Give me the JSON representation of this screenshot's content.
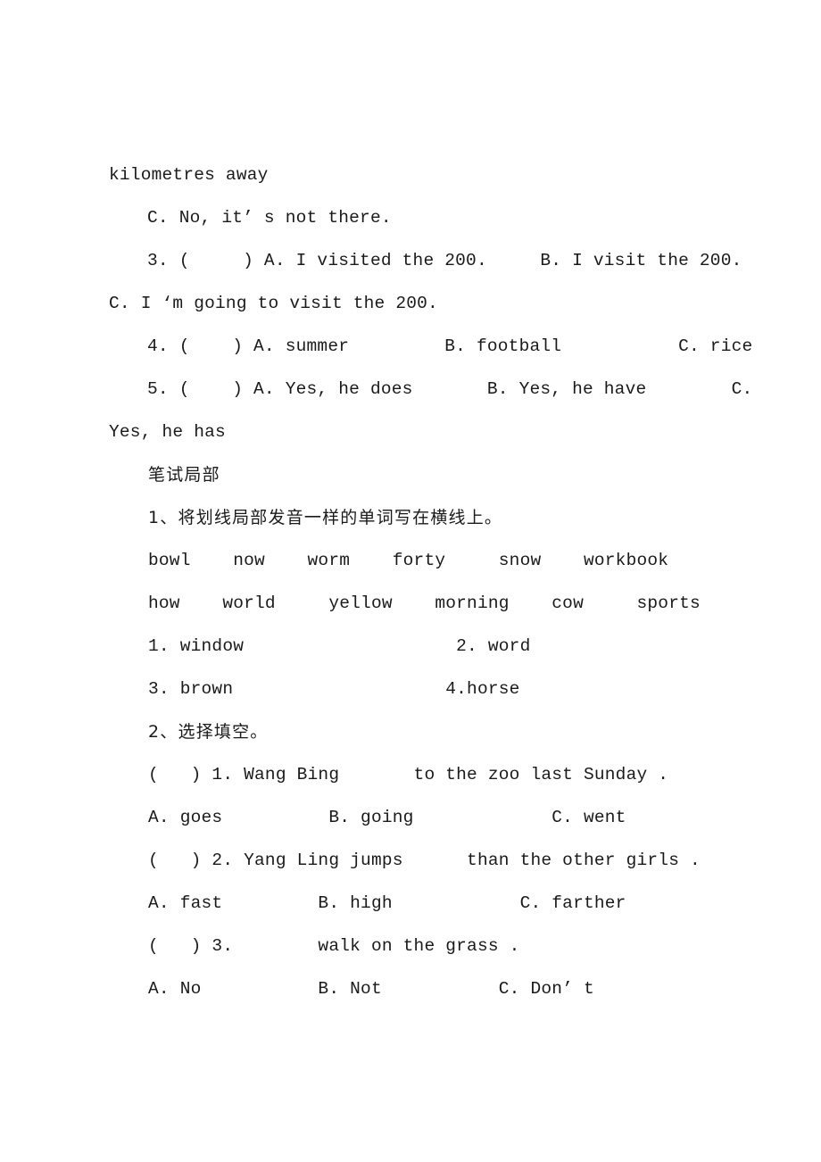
{
  "document": {
    "background_color": "#ffffff",
    "text_color": "#1a1a1a",
    "lines": [
      {
        "id": "l01",
        "text": "kilometres away",
        "indent": "flush",
        "script": "latin"
      },
      {
        "id": "l02",
        "text": "C. No, it’ s not there.",
        "indent": "ind1",
        "script": "latin"
      },
      {
        "id": "l03",
        "text": "3. (     ) A. I visited the 200.     B. I visit the 200.",
        "indent": "ind1",
        "script": "latin"
      },
      {
        "id": "l04",
        "text": "C. I ‘m going to visit the 200.",
        "indent": "flush",
        "script": "latin"
      },
      {
        "id": "l05",
        "text": "4. (    ) A. summer         B. football           C. rice",
        "indent": "ind1",
        "script": "latin"
      },
      {
        "id": "l06",
        "text": "5. (    ) A. Yes, he does       B. Yes, he have        C.",
        "indent": "ind1",
        "script": "latin"
      },
      {
        "id": "l07",
        "text": "Yes, he has",
        "indent": "flush",
        "script": "latin"
      },
      {
        "id": "l08",
        "text": "笔试局部",
        "indent": "ind2",
        "script": "cjk"
      },
      {
        "id": "l09",
        "text": "1、将划线局部发音一样的单词写在横线上。",
        "indent": "ind2",
        "script": "cjk-mixed"
      },
      {
        "id": "l10",
        "text": "bowl    now    worm    forty     snow    workbook",
        "indent": "ind2",
        "script": "latin"
      },
      {
        "id": "l11",
        "text": "how    world     yellow    morning    cow     sports",
        "indent": "ind2",
        "script": "latin"
      },
      {
        "id": "l12",
        "text": "1. window                    2. word",
        "indent": "ind2",
        "script": "latin"
      },
      {
        "id": "l13",
        "text": "3. brown                    4.horse",
        "indent": "ind2",
        "script": "latin"
      },
      {
        "id": "l14",
        "text": "2、选择填空。",
        "indent": "ind2",
        "script": "cjk-mixed"
      },
      {
        "id": "l15",
        "text": "(   ) 1. Wang Bing       to the zoo last Sunday .",
        "indent": "ind2",
        "script": "latin"
      },
      {
        "id": "l16",
        "text": "A. goes          B. going             C. went",
        "indent": "ind2",
        "script": "latin"
      },
      {
        "id": "l17",
        "text": "(   ) 2. Yang Ling jumps      than the other girls .",
        "indent": "ind2",
        "script": "latin"
      },
      {
        "id": "l18",
        "text": "A. fast         B. high            C. farther",
        "indent": "ind2",
        "script": "latin"
      },
      {
        "id": "l19",
        "text": "(   ) 3.        walk on the grass .",
        "indent": "ind2",
        "script": "latin"
      },
      {
        "id": "l20",
        "text": "A. No           B. Not           C. Don’ t",
        "indent": "ind2",
        "script": "latin"
      }
    ]
  }
}
